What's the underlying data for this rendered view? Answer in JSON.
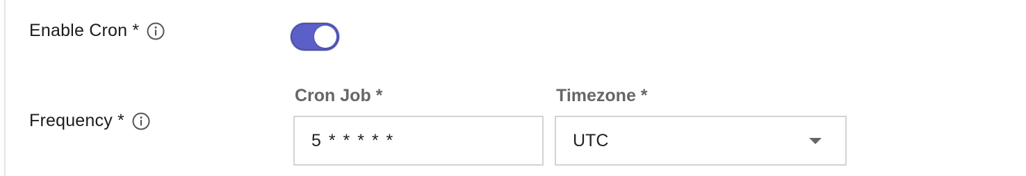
{
  "enable_cron": {
    "label": "Enable Cron *",
    "info_icon": "info-icon",
    "toggle_on": true,
    "accent_color": "#5b5fc7"
  },
  "frequency": {
    "label": "Frequency *",
    "info_icon": "info-icon",
    "cron_job": {
      "label": "Cron Job *",
      "value": "5 * * * * *"
    },
    "timezone": {
      "label": "Timezone *",
      "selected": "UTC",
      "dropdown_icon": "caret-down-icon"
    }
  }
}
